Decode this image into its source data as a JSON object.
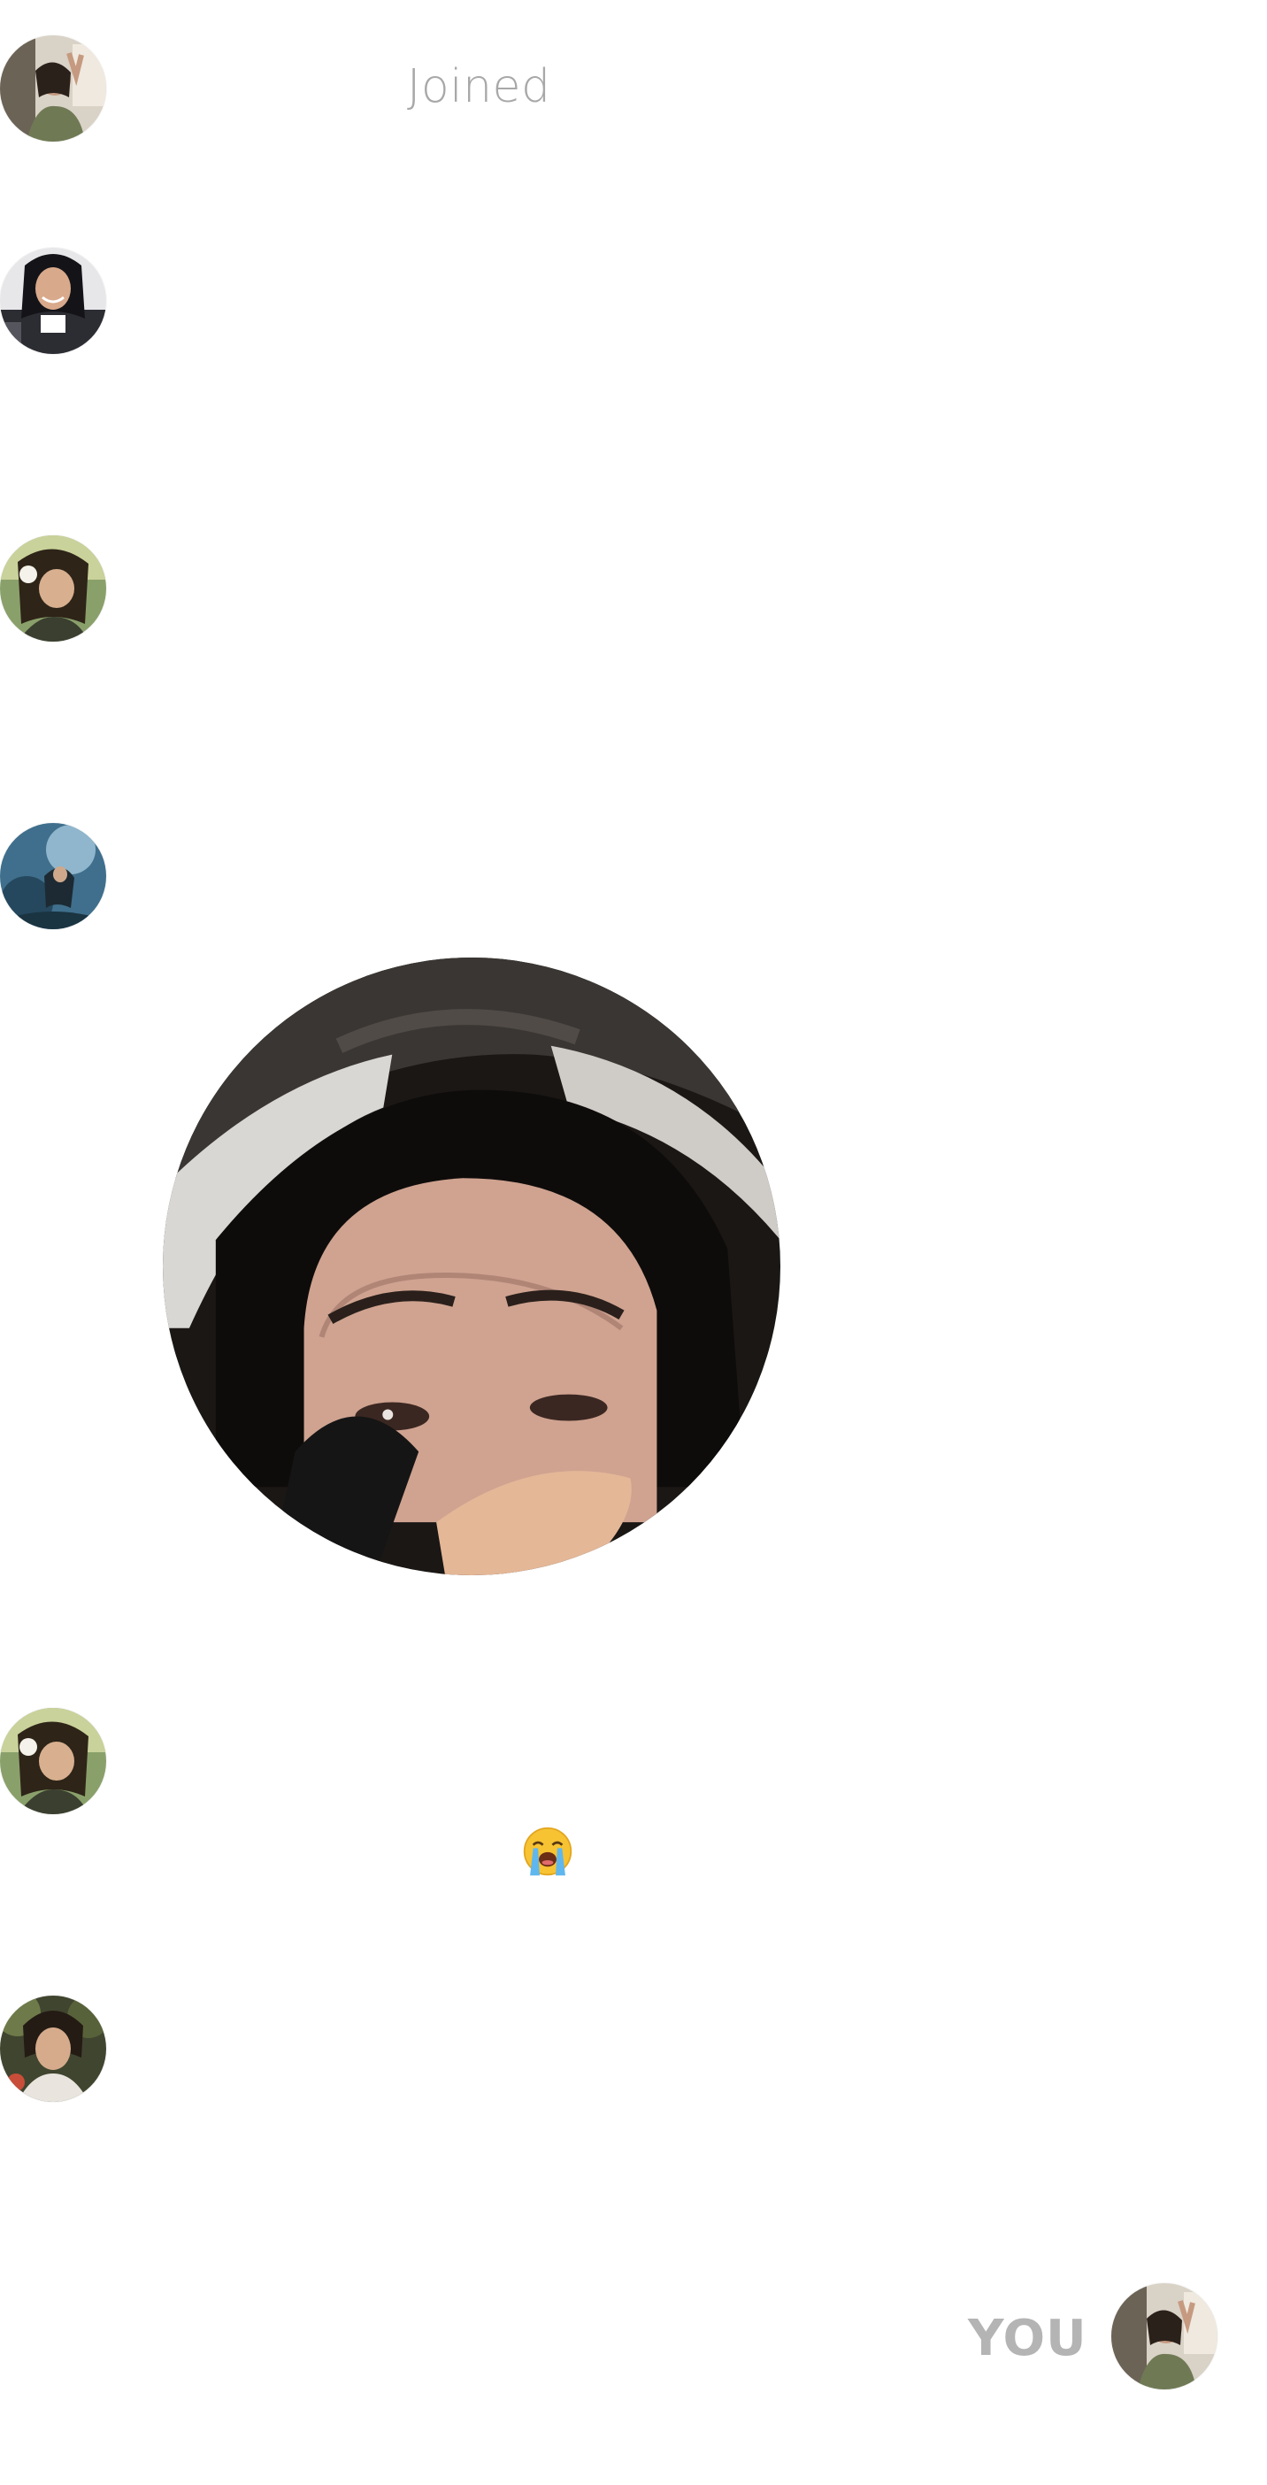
{
  "feed": {
    "events": [
      {
        "type": "status",
        "text": "Joined",
        "avatar": "user-avatar-1"
      },
      {
        "type": "avatar-only",
        "avatar": "user-avatar-2"
      },
      {
        "type": "avatar-only",
        "avatar": "user-avatar-3"
      },
      {
        "type": "photo",
        "avatar": "user-avatar-4",
        "photo": "crying-selfie-photo"
      },
      {
        "type": "emoji",
        "avatar": "user-avatar-3",
        "emoji": "😭",
        "emoji_name": "loudly-crying-face-icon"
      },
      {
        "type": "avatar-only",
        "avatar": "user-avatar-5"
      }
    ],
    "self": {
      "label": "YOU",
      "avatar": "user-avatar-self"
    }
  },
  "colors": {
    "background": "#ffffff",
    "muted_text": "#a8a8a8",
    "you_label": "#b4b4b4"
  }
}
